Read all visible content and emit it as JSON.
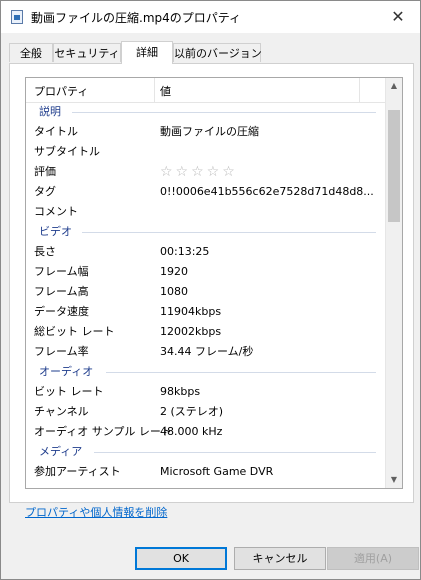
{
  "window": {
    "title": "動画ファイルの圧縮.mp4のプロパティ",
    "close_glyph": "✕",
    "file_icon": "video-file-icon"
  },
  "tabs": [
    {
      "label": "全般"
    },
    {
      "label": "セキュリティ"
    },
    {
      "label": "詳細",
      "active": true
    },
    {
      "label": "以前のバージョン"
    }
  ],
  "table": {
    "col_property": "プロパティ",
    "col_value": "値",
    "groups": [
      {
        "label": "説明",
        "rows": [
          {
            "key": "タイトル",
            "value": "動画ファイルの圧縮"
          },
          {
            "key": "サブタイトル",
            "value": ""
          },
          {
            "key": "評価",
            "value": "☆☆☆☆☆"
          },
          {
            "key": "タグ",
            "value": "0!!0006e41b556c62e7528d71d48d8..."
          },
          {
            "key": "コメント",
            "value": ""
          }
        ]
      },
      {
        "label": "ビデオ",
        "rows": [
          {
            "key": "長さ",
            "value": "00:13:25"
          },
          {
            "key": "フレーム幅",
            "value": "1920"
          },
          {
            "key": "フレーム高",
            "value": "1080"
          },
          {
            "key": "データ速度",
            "value": "11904kbps"
          },
          {
            "key": "総ビット レート",
            "value": "12002kbps"
          },
          {
            "key": "フレーム率",
            "value": "34.44 フレーム/秒"
          }
        ]
      },
      {
        "label": "オーディオ",
        "rows": [
          {
            "key": "ビット レート",
            "value": "98kbps"
          },
          {
            "key": "チャンネル",
            "value": "2 (ステレオ)"
          },
          {
            "key": "オーディオ サンプル レート",
            "value": "48.000 kHz"
          }
        ]
      },
      {
        "label": "メディア",
        "rows": [
          {
            "key": "参加アーティスト",
            "value": "Microsoft Game DVR"
          }
        ]
      }
    ]
  },
  "scrollbar": {
    "up_glyph": "▲",
    "down_glyph": "▼"
  },
  "remove_link": "プロパティや個人情報を削除",
  "buttons": {
    "ok": "OK",
    "cancel": "キャンセル",
    "apply": "適用(A)"
  },
  "colors": {
    "group_label": "#1e3c8c",
    "link": "#0066cc",
    "ok_border": "#0078d7"
  }
}
